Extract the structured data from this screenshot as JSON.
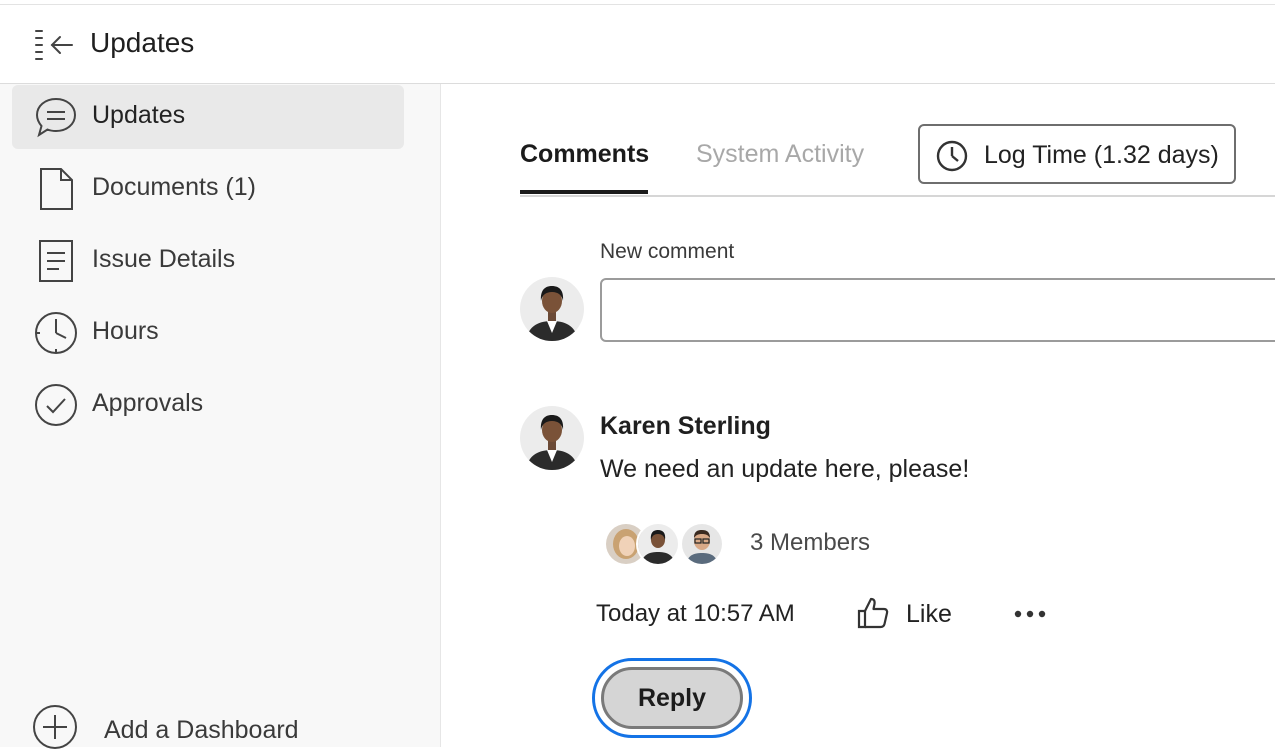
{
  "header": {
    "title": "Updates",
    "collapse_icon": "sidebar-collapse-icon"
  },
  "sidebar": {
    "items": [
      {
        "label": "Updates",
        "icon": "chat-bubble-icon",
        "active": true
      },
      {
        "label": "Documents (1)",
        "icon": "document-icon",
        "active": false
      },
      {
        "label": "Issue Details",
        "icon": "details-icon",
        "active": false
      },
      {
        "label": "Hours",
        "icon": "clock-icon",
        "active": false
      },
      {
        "label": "Approvals",
        "icon": "check-circle-icon",
        "active": false
      }
    ],
    "add_dashboard": {
      "label": "Add a Dashboard",
      "icon": "plus-circle-icon"
    }
  },
  "tabs": [
    {
      "label": "Comments",
      "active": true
    },
    {
      "label": "System Activity",
      "active": false
    }
  ],
  "log_time": {
    "label": "Log Time (1.32 days)",
    "icon": "clock-icon"
  },
  "new_comment": {
    "label": "New comment",
    "value": "",
    "placeholder": ""
  },
  "comment": {
    "author": "Karen Sterling",
    "text": "We need an update here, please!",
    "members_label": "3 Members",
    "timestamp": "Today at 10:57 AM",
    "like_label": "Like",
    "like_icon": "thumbs-up-icon",
    "more_icon": "more-horizontal-icon",
    "reply_label": "Reply"
  },
  "colors": {
    "accent_focus": "#1473e6",
    "sidebar_bg": "#f8f8f8",
    "active_item_bg": "#e9e9e9",
    "inactive_tab": "#a8a8a8"
  }
}
